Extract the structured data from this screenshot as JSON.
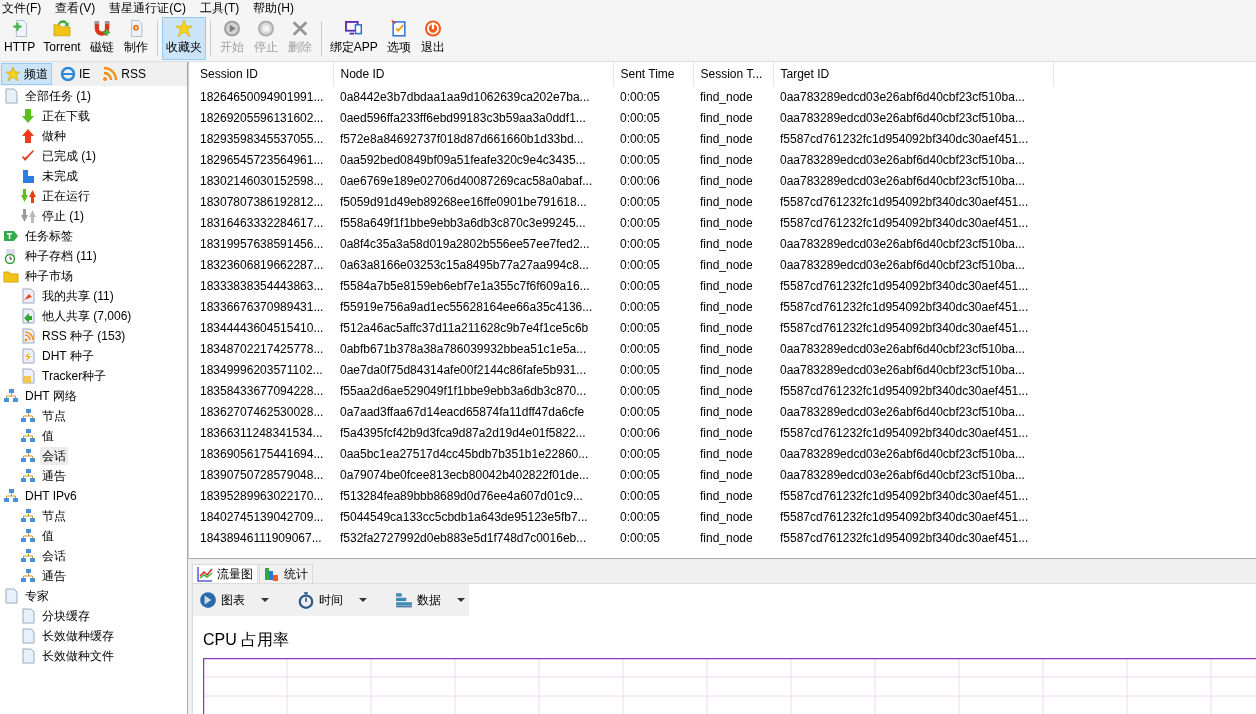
{
  "menu": [
    "文件(F)",
    "查看(V)",
    "彗星通行证(C)",
    "工具(T)",
    "帮助(H)"
  ],
  "toolbar": [
    [
      {
        "label": "HTTP",
        "disabled": false,
        "selected": false
      },
      {
        "label": "Torrent",
        "disabled": false,
        "selected": false
      },
      {
        "label": "磁链",
        "disabled": false,
        "selected": false
      },
      {
        "label": "制作",
        "disabled": false,
        "selected": false
      }
    ],
    [
      {
        "label": "收藏夹",
        "disabled": false,
        "selected": true
      }
    ],
    [
      {
        "label": "开始",
        "disabled": true,
        "selected": false
      },
      {
        "label": "停止",
        "disabled": true,
        "selected": false
      },
      {
        "label": "删除",
        "disabled": true,
        "selected": false
      }
    ],
    [
      {
        "label": "绑定APP",
        "disabled": false,
        "selected": false
      },
      {
        "label": "选项",
        "disabled": false,
        "selected": false
      },
      {
        "label": "退出",
        "disabled": false,
        "selected": false
      }
    ]
  ],
  "sidebar": {
    "tabs": [
      {
        "label": "频道",
        "selected": true
      },
      {
        "label": "IE",
        "selected": false
      },
      {
        "label": "RSS",
        "selected": false
      }
    ],
    "tree": [
      {
        "label": "全部任务 (1)",
        "selected": false,
        "children": [
          {
            "label": "正在下载",
            "selected": false
          },
          {
            "label": "做种",
            "selected": false
          },
          {
            "label": "已完成 (1)",
            "selected": false
          },
          {
            "label": "未完成",
            "selected": false
          },
          {
            "label": "正在运行",
            "selected": false
          },
          {
            "label": "停止 (1)",
            "selected": false
          }
        ]
      },
      {
        "label": "任务标签",
        "selected": false
      },
      {
        "label": "种子存档 (11)",
        "selected": false
      },
      {
        "label": "种子市场",
        "selected": false,
        "children": [
          {
            "label": "我的共享 (11)",
            "selected": false
          },
          {
            "label": "他人共享 (7,006)",
            "selected": false
          },
          {
            "label": "RSS 种子 (153)",
            "selected": false
          },
          {
            "label": "DHT 种子",
            "selected": false
          },
          {
            "label": "Tracker种子",
            "selected": false
          }
        ]
      },
      {
        "label": "DHT 网络",
        "selected": false,
        "children": [
          {
            "label": "节点",
            "selected": false
          },
          {
            "label": "值",
            "selected": false
          },
          {
            "label": "会话",
            "selected": true
          },
          {
            "label": "通告",
            "selected": false
          }
        ]
      },
      {
        "label": "DHT IPv6",
        "selected": false,
        "children": [
          {
            "label": "节点",
            "selected": false
          },
          {
            "label": "值",
            "selected": false
          },
          {
            "label": "会话",
            "selected": false
          },
          {
            "label": "通告",
            "selected": false
          }
        ]
      },
      {
        "label": "专家",
        "selected": false,
        "children": [
          {
            "label": "分块缓存",
            "selected": false
          },
          {
            "label": "长效做种缓存",
            "selected": false
          },
          {
            "label": "长效做种文件",
            "selected": false
          }
        ]
      }
    ]
  },
  "table": {
    "columns": [
      "Session ID",
      "Node ID",
      "Sent Time",
      "Session T...",
      "Target ID"
    ],
    "rows": [
      [
        "18264650094901991...",
        "0a8442e3b7dbdaa1aa9d1062639ca202e7ba...",
        "0:00:05",
        "find_node",
        "0aa783289edcd03e26abf6d40cbf23cf510ba..."
      ],
      [
        "18269205596131602...",
        "0aed596ffa233ff6ebd99183c3b59aa3a0ddf1...",
        "0:00:05",
        "find_node",
        "0aa783289edcd03e26abf6d40cbf23cf510ba..."
      ],
      [
        "18293598345537055...",
        "f572e8a84692737f018d87d661660b1d33bd...",
        "0:00:05",
        "find_node",
        "f5587cd761232fc1d954092bf340dc30aef451..."
      ],
      [
        "18296545723564961...",
        "0aa592bed0849bf09a51feafe320c9e4c3435...",
        "0:00:05",
        "find_node",
        "0aa783289edcd03e26abf6d40cbf23cf510ba..."
      ],
      [
        "18302146030152598...",
        "0ae6769e189e02706d40087269cac58a0abaf...",
        "0:00:06",
        "find_node",
        "0aa783289edcd03e26abf6d40cbf23cf510ba..."
      ],
      [
        "18307807386192812...",
        "f5059d91d49eb89268ee16ffe0901be791618...",
        "0:00:05",
        "find_node",
        "f5587cd761232fc1d954092bf340dc30aef451..."
      ],
      [
        "18316463332284617...",
        "f558a649f1f1bbe9ebb3a6db3c870c3e99245...",
        "0:00:05",
        "find_node",
        "f5587cd761232fc1d954092bf340dc30aef451..."
      ],
      [
        "18319957638591456...",
        "0a8f4c35a3a58d019a2802b556ee57ee7fed2...",
        "0:00:05",
        "find_node",
        "0aa783289edcd03e26abf6d40cbf23cf510ba..."
      ],
      [
        "18323606819662287...",
        "0a63a8166e03253c15a8495b77a27aa994c8...",
        "0:00:05",
        "find_node",
        "0aa783289edcd03e26abf6d40cbf23cf510ba..."
      ],
      [
        "18333838354443863...",
        "f5584a7b5e8159eb6ebf7e1a355c7f6f609a16...",
        "0:00:05",
        "find_node",
        "f5587cd761232fc1d954092bf340dc30aef451..."
      ],
      [
        "18336676370989431...",
        "f55919e756a9ad1ec55628164ee66a35c4136...",
        "0:00:05",
        "find_node",
        "f5587cd761232fc1d954092bf340dc30aef451..."
      ],
      [
        "18344443604515410...",
        "f512a46ac5affc37d11a211628c9b7e4f1ce5c6b",
        "0:00:05",
        "find_node",
        "f5587cd761232fc1d954092bf340dc30aef451..."
      ],
      [
        "18348702217425778...",
        "0abfb671b378a38a786039932bbea51c1e5a...",
        "0:00:05",
        "find_node",
        "0aa783289edcd03e26abf6d40cbf23cf510ba..."
      ],
      [
        "18349996203571102...",
        "0ae7da0f75d84314afe00f2144c86fafe5b931...",
        "0:00:05",
        "find_node",
        "0aa783289edcd03e26abf6d40cbf23cf510ba..."
      ],
      [
        "18358433677094228...",
        "f55aa2d6ae529049f1f1bbe9ebb3a6db3c870...",
        "0:00:05",
        "find_node",
        "f5587cd761232fc1d954092bf340dc30aef451..."
      ],
      [
        "18362707462530028...",
        "0a7aad3ffaa67d14eacd65874fa11dff47da6cfe",
        "0:00:05",
        "find_node",
        "0aa783289edcd03e26abf6d40cbf23cf510ba..."
      ],
      [
        "18366311248341534...",
        "f5a4395fcf42b9d3fca9d87a2d19d4e01f5822...",
        "0:00:06",
        "find_node",
        "f5587cd761232fc1d954092bf340dc30aef451..."
      ],
      [
        "18369056175441694...",
        "0aa5bc1ea27517d4cc45bdb7b351b1e22860...",
        "0:00:05",
        "find_node",
        "0aa783289edcd03e26abf6d40cbf23cf510ba..."
      ],
      [
        "18390750728579048...",
        "0a79074be0fcee813ecb80042b402822f01de...",
        "0:00:05",
        "find_node",
        "0aa783289edcd03e26abf6d40cbf23cf510ba..."
      ],
      [
        "18395289963022170...",
        "f513284fea89bbb8689d0d76ee4a607d01c9...",
        "0:00:05",
        "find_node",
        "f5587cd761232fc1d954092bf340dc30aef451..."
      ],
      [
        "18402745139042709...",
        "f5044549ca133cc5cbdb1a643de95123e5fb7...",
        "0:00:05",
        "find_node",
        "f5587cd761232fc1d954092bf340dc30aef451..."
      ],
      [
        "18438946111909067...",
        "f532fa2727992d0eb883e5d1f748d7c0016eb...",
        "0:00:05",
        "find_node",
        "f5587cd761232fc1d954092bf340dc30aef451..."
      ]
    ]
  },
  "bottom_tabs": [
    {
      "label": "流量图",
      "selected": true
    },
    {
      "label": "统计",
      "selected": false
    }
  ],
  "chart_toolbar": [
    "图表",
    "时间",
    "数据"
  ],
  "chart_title": "CPU 占用率"
}
